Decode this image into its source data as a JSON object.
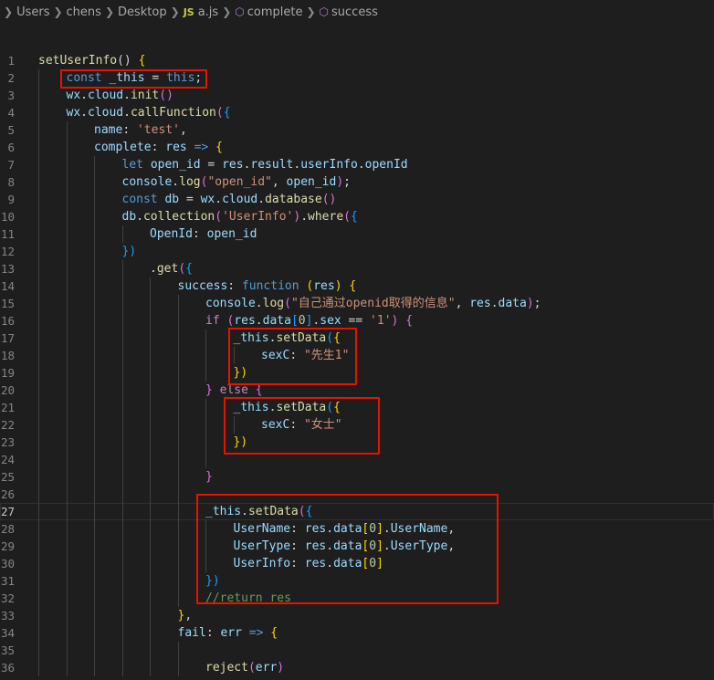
{
  "breadcrumb": {
    "items": [
      "Users",
      "chens",
      "Desktop",
      "a.js",
      "complete",
      "success"
    ],
    "js_badge": "JS"
  },
  "editor": {
    "current_line": 27,
    "lines": [
      {
        "n": "1",
        "indent": 0,
        "t": [
          [
            "setUserInfo",
            "f"
          ],
          [
            "() ",
            "p"
          ],
          [
            "{",
            "b1"
          ]
        ]
      },
      {
        "n": "2",
        "indent": 1,
        "t": [
          [
            "const ",
            "k"
          ],
          [
            "_this",
            "v"
          ],
          [
            " = ",
            "p"
          ],
          [
            "this",
            "k"
          ],
          [
            ";",
            "p"
          ]
        ]
      },
      {
        "n": "3",
        "indent": 1,
        "t": [
          [
            "wx",
            "v"
          ],
          [
            ".",
            "p"
          ],
          [
            "cloud",
            "v"
          ],
          [
            ".",
            "p"
          ],
          [
            "init",
            "f"
          ],
          [
            "()",
            "b2"
          ]
        ]
      },
      {
        "n": "4",
        "indent": 1,
        "t": [
          [
            "wx",
            "v"
          ],
          [
            ".",
            "p"
          ],
          [
            "cloud",
            "v"
          ],
          [
            ".",
            "p"
          ],
          [
            "callFunction",
            "f"
          ],
          [
            "(",
            "b2"
          ],
          [
            "{",
            "b3"
          ]
        ]
      },
      {
        "n": "5",
        "indent": 2,
        "t": [
          [
            "name",
            "v"
          ],
          [
            ": ",
            "p"
          ],
          [
            "'test'",
            "s"
          ],
          [
            ",",
            "p"
          ]
        ]
      },
      {
        "n": "6",
        "indent": 2,
        "t": [
          [
            "complete",
            "v"
          ],
          [
            ": ",
            "p"
          ],
          [
            "res",
            "v"
          ],
          [
            " => ",
            "k"
          ],
          [
            "{",
            "b1"
          ]
        ]
      },
      {
        "n": "7",
        "indent": 3,
        "t": [
          [
            "let ",
            "k"
          ],
          [
            "open_id",
            "v"
          ],
          [
            " = ",
            "p"
          ],
          [
            "res",
            "v"
          ],
          [
            ".",
            "p"
          ],
          [
            "result",
            "v"
          ],
          [
            ".",
            "p"
          ],
          [
            "userInfo",
            "v"
          ],
          [
            ".",
            "p"
          ],
          [
            "openId",
            "v"
          ]
        ]
      },
      {
        "n": "8",
        "indent": 3,
        "t": [
          [
            "console",
            "v"
          ],
          [
            ".",
            "p"
          ],
          [
            "log",
            "f"
          ],
          [
            "(",
            "b2"
          ],
          [
            "\"open_id\"",
            "s"
          ],
          [
            ", ",
            "p"
          ],
          [
            "open_id",
            "v"
          ],
          [
            ")",
            "b2"
          ],
          [
            ";",
            "p"
          ]
        ]
      },
      {
        "n": "9",
        "indent": 3,
        "t": [
          [
            "const ",
            "k"
          ],
          [
            "db",
            "v"
          ],
          [
            " = ",
            "p"
          ],
          [
            "wx",
            "v"
          ],
          [
            ".",
            "p"
          ],
          [
            "cloud",
            "v"
          ],
          [
            ".",
            "p"
          ],
          [
            "database",
            "f"
          ],
          [
            "()",
            "b2"
          ]
        ]
      },
      {
        "n": "10",
        "indent": 3,
        "t": [
          [
            "db",
            "v"
          ],
          [
            ".",
            "p"
          ],
          [
            "collection",
            "f"
          ],
          [
            "(",
            "b2"
          ],
          [
            "'UserInfo'",
            "s"
          ],
          [
            ")",
            "b2"
          ],
          [
            ".",
            "p"
          ],
          [
            "where",
            "f"
          ],
          [
            "(",
            "b2"
          ],
          [
            "{",
            "b3"
          ]
        ]
      },
      {
        "n": "11",
        "indent": 4,
        "t": [
          [
            "OpenId",
            "v"
          ],
          [
            ": ",
            "p"
          ],
          [
            "open_id",
            "v"
          ]
        ]
      },
      {
        "n": "12",
        "indent": 3,
        "t": [
          [
            "})",
            "b3"
          ]
        ]
      },
      {
        "n": "13",
        "indent": 4,
        "t": [
          [
            ".",
            "p"
          ],
          [
            "get",
            "f"
          ],
          [
            "(",
            "b2"
          ],
          [
            "{",
            "b3"
          ]
        ]
      },
      {
        "n": "14",
        "indent": 5,
        "t": [
          [
            "success",
            "v"
          ],
          [
            ": ",
            "p"
          ],
          [
            "function ",
            "k"
          ],
          [
            "(",
            "b1"
          ],
          [
            "res",
            "v"
          ],
          [
            ") ",
            "b1"
          ],
          [
            "{",
            "b1"
          ]
        ]
      },
      {
        "n": "15",
        "indent": 6,
        "t": [
          [
            "console",
            "v"
          ],
          [
            ".",
            "p"
          ],
          [
            "log",
            "f"
          ],
          [
            "(",
            "b2"
          ],
          [
            "\"自己通过openid取得的信息\"",
            "s"
          ],
          [
            ", ",
            "p"
          ],
          [
            "res",
            "v"
          ],
          [
            ".",
            "p"
          ],
          [
            "data",
            "v"
          ],
          [
            ")",
            "b2"
          ],
          [
            ";",
            "p"
          ]
        ]
      },
      {
        "n": "16",
        "indent": 6,
        "t": [
          [
            "if ",
            "kc"
          ],
          [
            "(",
            "b2"
          ],
          [
            "res",
            "v"
          ],
          [
            ".",
            "p"
          ],
          [
            "data",
            "v"
          ],
          [
            "[",
            "b3"
          ],
          [
            "0",
            "n"
          ],
          [
            "]",
            "b3"
          ],
          [
            ".",
            "p"
          ],
          [
            "sex",
            "v"
          ],
          [
            " == ",
            "p"
          ],
          [
            "'1'",
            "s"
          ],
          [
            ") ",
            "b2"
          ],
          [
            "{",
            "b2"
          ]
        ]
      },
      {
        "n": "17",
        "indent": 7,
        "t": [
          [
            "_this",
            "v"
          ],
          [
            ".",
            "p"
          ],
          [
            "setData",
            "f"
          ],
          [
            "(",
            "b3"
          ],
          [
            "{",
            "b1"
          ]
        ]
      },
      {
        "n": "18",
        "indent": 8,
        "t": [
          [
            "sexC",
            "v"
          ],
          [
            ": ",
            "p"
          ],
          [
            "\"先生1\"",
            "s"
          ]
        ]
      },
      {
        "n": "19",
        "indent": 7,
        "t": [
          [
            "})",
            "b1"
          ]
        ]
      },
      {
        "n": "20",
        "indent": 6,
        "t": [
          [
            "} ",
            "b2"
          ],
          [
            "else ",
            "kc"
          ],
          [
            "{",
            "b2"
          ]
        ]
      },
      {
        "n": "21",
        "indent": 7,
        "t": [
          [
            "_this",
            "v"
          ],
          [
            ".",
            "p"
          ],
          [
            "setData",
            "f"
          ],
          [
            "(",
            "b3"
          ],
          [
            "{",
            "b1"
          ]
        ]
      },
      {
        "n": "22",
        "indent": 8,
        "t": [
          [
            "sexC",
            "v"
          ],
          [
            ": ",
            "p"
          ],
          [
            "\"女士\"",
            "s"
          ]
        ]
      },
      {
        "n": "23",
        "indent": 7,
        "t": [
          [
            "})",
            "b1"
          ]
        ]
      },
      {
        "n": "24",
        "indent": 7,
        "t": []
      },
      {
        "n": "25",
        "indent": 6,
        "t": [
          [
            "}",
            "b2"
          ]
        ]
      },
      {
        "n": "26",
        "indent": 6,
        "t": []
      },
      {
        "n": "27",
        "indent": 6,
        "t": [
          [
            "_this",
            "v"
          ],
          [
            ".",
            "p"
          ],
          [
            "setData",
            "f"
          ],
          [
            "(",
            "b2"
          ],
          [
            "{",
            "b3"
          ]
        ]
      },
      {
        "n": "28",
        "indent": 7,
        "t": [
          [
            "UserName",
            "v"
          ],
          [
            ": ",
            "p"
          ],
          [
            "res",
            "v"
          ],
          [
            ".",
            "p"
          ],
          [
            "data",
            "v"
          ],
          [
            "[",
            "b1"
          ],
          [
            "0",
            "n"
          ],
          [
            "]",
            "b1"
          ],
          [
            ".",
            "p"
          ],
          [
            "UserName",
            "v"
          ],
          [
            ",",
            "p"
          ]
        ]
      },
      {
        "n": "29",
        "indent": 7,
        "t": [
          [
            "UserType",
            "v"
          ],
          [
            ": ",
            "p"
          ],
          [
            "res",
            "v"
          ],
          [
            ".",
            "p"
          ],
          [
            "data",
            "v"
          ],
          [
            "[",
            "b1"
          ],
          [
            "0",
            "n"
          ],
          [
            "]",
            "b1"
          ],
          [
            ".",
            "p"
          ],
          [
            "UserType",
            "v"
          ],
          [
            ",",
            "p"
          ]
        ]
      },
      {
        "n": "30",
        "indent": 7,
        "t": [
          [
            "UserInfo",
            "v"
          ],
          [
            ": ",
            "p"
          ],
          [
            "res",
            "v"
          ],
          [
            ".",
            "p"
          ],
          [
            "data",
            "v"
          ],
          [
            "[",
            "b1"
          ],
          [
            "0",
            "n"
          ],
          [
            "]",
            "b1"
          ]
        ]
      },
      {
        "n": "31",
        "indent": 6,
        "t": [
          [
            "})",
            "b3"
          ]
        ]
      },
      {
        "n": "32",
        "indent": 6,
        "t": [
          [
            "//return res",
            "c"
          ]
        ]
      },
      {
        "n": "33",
        "indent": 5,
        "t": [
          [
            "}",
            "b1"
          ],
          [
            ",",
            "p"
          ]
        ]
      },
      {
        "n": "34",
        "indent": 5,
        "t": [
          [
            "fail",
            "v"
          ],
          [
            ": ",
            "p"
          ],
          [
            "err",
            "v"
          ],
          [
            " => ",
            "k"
          ],
          [
            "{",
            "b1"
          ]
        ]
      },
      {
        "n": "35",
        "indent": 6,
        "t": []
      },
      {
        "n": "36",
        "indent": 6,
        "t": [
          [
            "reject",
            "f"
          ],
          [
            "(",
            "b2"
          ],
          [
            "err",
            "v"
          ],
          [
            ")",
            "b2"
          ]
        ]
      }
    ]
  },
  "colors": {
    "background": "#1e1e1e",
    "highlight_box": "#e51400"
  }
}
